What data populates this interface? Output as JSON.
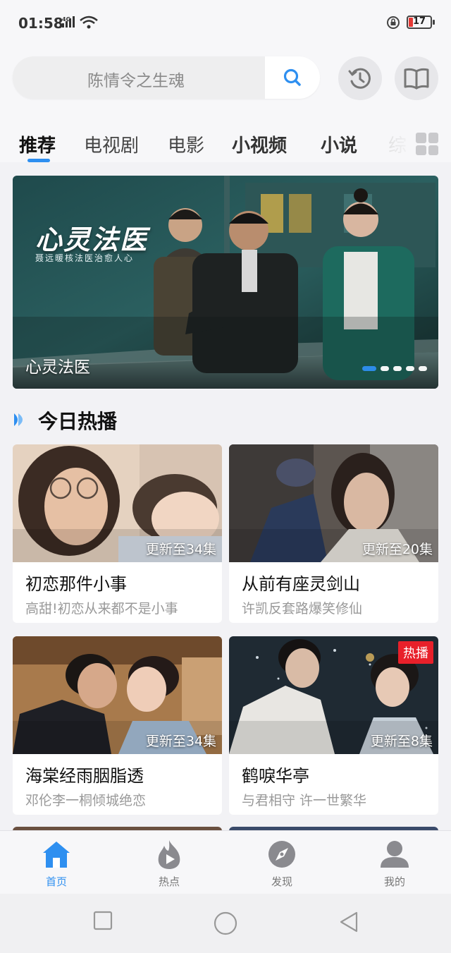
{
  "status_bar": {
    "time": "01:58",
    "battery": "17"
  },
  "search": {
    "placeholder": "陈情令之生魂"
  },
  "tabs": [
    {
      "label": "推荐",
      "active": true
    },
    {
      "label": "电视剧"
    },
    {
      "label": "电影"
    },
    {
      "label": "小视频"
    },
    {
      "label": "小说"
    },
    {
      "label": "综"
    }
  ],
  "banner": {
    "overlay_title": "心灵法医",
    "overlay_subtitle": "聂远暖核法医治愈人心",
    "caption": "心灵法医",
    "dot_count": 5,
    "active_dot": 0
  },
  "section": {
    "title": "今日热播"
  },
  "cards": [
    {
      "title": "初恋那件小事",
      "desc": "高甜!初恋从来都不是小事",
      "update": "更新至34集"
    },
    {
      "title": "从前有座灵剑山",
      "desc": "许凯反套路爆笑修仙",
      "update": "更新至20集"
    },
    {
      "title": "海棠经雨胭脂透",
      "desc": "邓伦李一桐倾城绝恋",
      "update": "更新至34集"
    },
    {
      "title": "鹤唳华亭",
      "desc": "与君相守 许一世繁华",
      "update": "更新至8集",
      "badge": "热播"
    }
  ],
  "bottom_nav": [
    {
      "label": "首页",
      "icon": "home-icon",
      "active": true
    },
    {
      "label": "热点",
      "icon": "flame-play-icon"
    },
    {
      "label": "发现",
      "icon": "compass-icon"
    },
    {
      "label": "我的",
      "icon": "user-icon"
    }
  ],
  "colors": {
    "accent": "#2e8ff0",
    "hot_badge": "#e8202a"
  }
}
